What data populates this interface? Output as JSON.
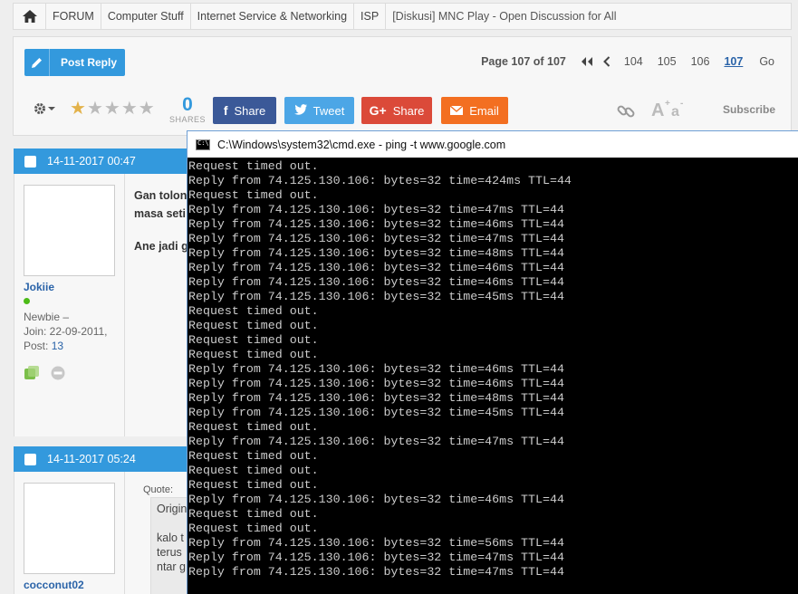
{
  "breadcrumb": {
    "items": [
      "FORUM",
      "Computer Stuff",
      "Internet Service & Networking",
      "ISP",
      "[Diskusi] MNC Play - Open Discussion for All"
    ]
  },
  "toolbar": {
    "post_reply_label": "Post Reply",
    "page_info": "Page 107 of 107",
    "pages": [
      "104",
      "105",
      "106",
      "107"
    ],
    "current_page": "107",
    "go_label": "Go",
    "rating_stars": 1,
    "shares_count": "0",
    "shares_label": "SHARES",
    "facebook_label": "Share",
    "twitter_label": "Tweet",
    "gplus_label": "Share",
    "email_label": "Email",
    "subscribe_label": "Subscribe",
    "colors": {
      "primary": "#3399dd",
      "facebook": "#3b5998",
      "twitter": "#4ca6e6",
      "gplus": "#db4a39",
      "email": "#f36f21"
    }
  },
  "posts": [
    {
      "date": "14-11-2017 00:47",
      "username": "Jokiie",
      "rank": "Newbie –",
      "join": "Join: 22-09-2011,",
      "post_label": "Post:",
      "post_count": "13",
      "content_lines": [
        "Gan tolon",
        "masa seti",
        "",
        "Ane jadi g"
      ]
    },
    {
      "date": "14-11-2017 05:24",
      "username": "cocconut02",
      "quote_label": "Quote:",
      "quote_lines": [
        "Origin",
        "",
        "kalo t",
        "terus",
        "ntar g"
      ]
    }
  ],
  "cmd": {
    "title": "C:\\Windows\\system32\\cmd.exe - ping  -t www.google.com",
    "lines": [
      "Request timed out.",
      "Reply from 74.125.130.106: bytes=32 time=424ms TTL=44",
      "Request timed out.",
      "Reply from 74.125.130.106: bytes=32 time=47ms TTL=44",
      "Reply from 74.125.130.106: bytes=32 time=46ms TTL=44",
      "Reply from 74.125.130.106: bytes=32 time=47ms TTL=44",
      "Reply from 74.125.130.106: bytes=32 time=48ms TTL=44",
      "Reply from 74.125.130.106: bytes=32 time=46ms TTL=44",
      "Reply from 74.125.130.106: bytes=32 time=46ms TTL=44",
      "Reply from 74.125.130.106: bytes=32 time=45ms TTL=44",
      "Request timed out.",
      "Request timed out.",
      "Request timed out.",
      "Request timed out.",
      "Reply from 74.125.130.106: bytes=32 time=46ms TTL=44",
      "Reply from 74.125.130.106: bytes=32 time=46ms TTL=44",
      "Reply from 74.125.130.106: bytes=32 time=48ms TTL=44",
      "Reply from 74.125.130.106: bytes=32 time=45ms TTL=44",
      "Request timed out.",
      "Reply from 74.125.130.106: bytes=32 time=47ms TTL=44",
      "Request timed out.",
      "Request timed out.",
      "Request timed out.",
      "Reply from 74.125.130.106: bytes=32 time=46ms TTL=44",
      "Request timed out.",
      "Request timed out.",
      "Reply from 74.125.130.106: bytes=32 time=56ms TTL=44",
      "Reply from 74.125.130.106: bytes=32 time=47ms TTL=44",
      "Reply from 74.125.130.106: bytes=32 time=47ms TTL=44"
    ]
  }
}
